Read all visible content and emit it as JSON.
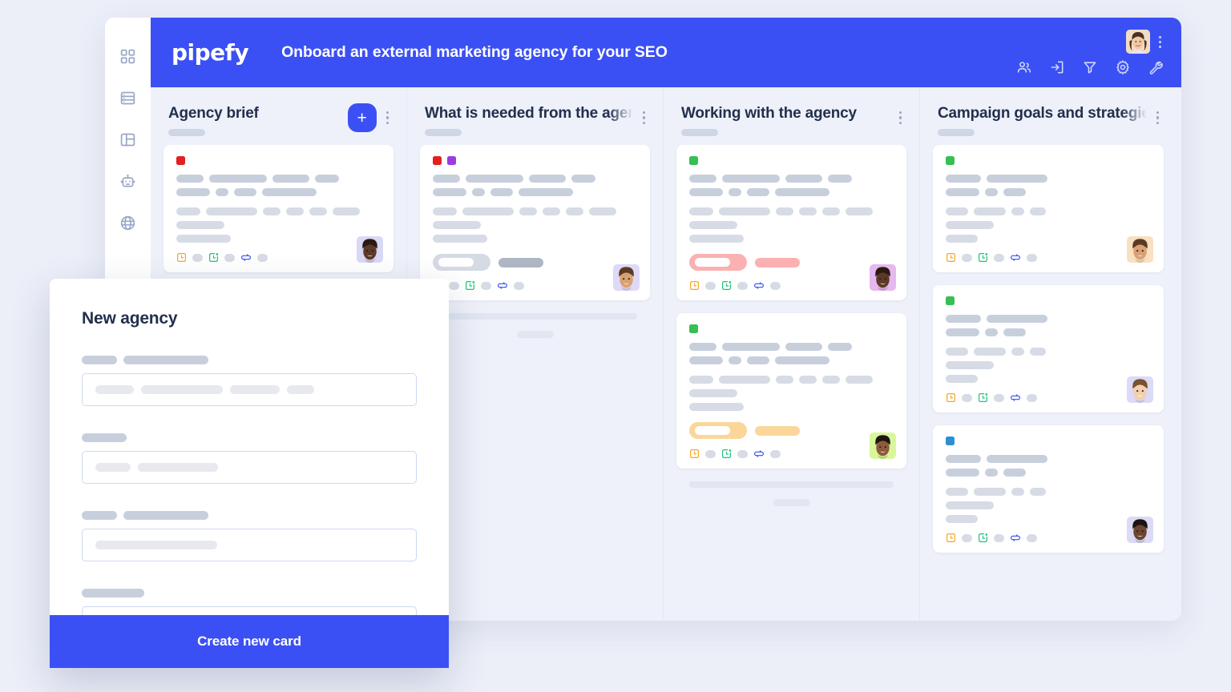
{
  "header": {
    "logo": "pipefy",
    "board_title": "Onboard an external marketing agency for your SEO",
    "icons": [
      {
        "name": "members-icon",
        "label": "Members"
      },
      {
        "name": "inbox-import-icon",
        "label": "Inbox"
      },
      {
        "name": "filter-icon",
        "label": "Filter"
      },
      {
        "name": "gear-icon",
        "label": "Settings"
      },
      {
        "name": "wrench-icon",
        "label": "Tools"
      }
    ],
    "avatar": "user-avatar",
    "overflow_menu": "kebab-menu",
    "accent_color": "#3b50f4"
  },
  "sidebar": {
    "items": [
      {
        "name": "dashboard-icon",
        "label": "Dashboard"
      },
      {
        "name": "database-icon",
        "label": "Database"
      },
      {
        "name": "board-layout-icon",
        "label": "Board"
      },
      {
        "name": "automation-robot-icon",
        "label": "Automations"
      },
      {
        "name": "portal-globe-icon",
        "label": "Portal"
      }
    ]
  },
  "board": {
    "add_button_label": "+",
    "columns": [
      {
        "title": "Agency brief",
        "cards": [
          {
            "labels": [
              "#e32020"
            ],
            "avatar_bg": "#d9d8f5",
            "badge": null,
            "footer_icons": [
              "clock-icon",
              "calendar-due-icon",
              "sync-flow-icon"
            ]
          }
        ],
        "ghost": true
      },
      {
        "title": "What is needed from the agency",
        "cards": [
          {
            "labels": [
              "#e32020",
              "#9b3ce0"
            ],
            "avatar_bg": "#ded9f7",
            "badge": {
              "fill": "#d5dae4",
              "bar": "#aeb6c4"
            },
            "footer_icons": [
              "clock-icon",
              "calendar-due-icon",
              "sync-flow-icon"
            ]
          }
        ],
        "ghost": true
      },
      {
        "title": "Working with the agency",
        "cards": [
          {
            "labels": [
              "#35bf55"
            ],
            "avatar_bg": "#e6b8f0",
            "badge": {
              "fill": "#fbb1b1",
              "bar": "#fbb1b1"
            },
            "footer_icons": [
              "clock-icon",
              "calendar-due-icon",
              "sync-flow-icon"
            ]
          },
          {
            "labels": [
              "#35bf55"
            ],
            "avatar_bg": "#d9f79a",
            "badge": {
              "fill": "#fbd69a",
              "bar": "#fbd69a"
            },
            "footer_icons": [
              "clock-icon",
              "calendar-due-icon",
              "sync-flow-icon"
            ]
          }
        ],
        "ghost": true
      },
      {
        "title": "Campaign goals and strategies",
        "cards": [
          {
            "labels": [
              "#35bf55"
            ],
            "avatar_bg": "#fadfc0",
            "badge": null,
            "footer_icons": [
              "clock-icon",
              "calendar-due-icon",
              "sync-flow-icon"
            ]
          },
          {
            "labels": [
              "#35bf55"
            ],
            "avatar_bg": "#dcdaf7",
            "badge": null,
            "footer_icons": [
              "clock-icon",
              "calendar-due-icon",
              "sync-flow-icon"
            ]
          },
          {
            "labels": [
              "#2b8fd4"
            ],
            "avatar_bg": "#dcdaf7",
            "badge": null,
            "footer_icons": [
              "clock-icon",
              "calendar-due-icon",
              "sync-flow-icon"
            ]
          }
        ],
        "ghost": false
      }
    ]
  },
  "modal": {
    "title": "New agency",
    "submit_label": "Create new card",
    "fields": [
      {
        "label_widths": [
          44,
          106
        ],
        "value_widths": [
          48,
          102,
          62,
          34
        ]
      },
      {
        "label_widths": [
          56
        ],
        "value_widths": [
          44,
          100
        ]
      },
      {
        "label_widths": [
          44,
          106
        ],
        "value_widths": [
          152
        ]
      },
      {
        "label_widths": [
          78
        ],
        "value_widths": [
          62
        ]
      }
    ]
  },
  "colors": {
    "brand_blue": "#3b50f4",
    "board_bg": "#eef1f9",
    "page_bg": "#eceff8",
    "text_dark": "#22304d",
    "icon_orange": "#f5a623",
    "icon_green": "#1ec27a",
    "icon_blue": "#3b50f4"
  }
}
